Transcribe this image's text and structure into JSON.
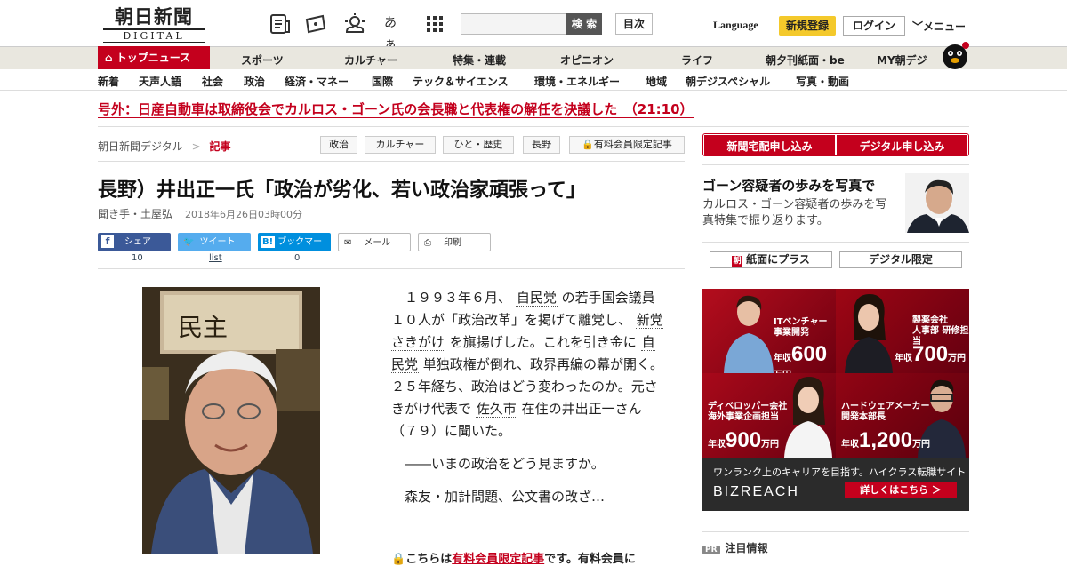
{
  "header": {
    "logo_jp": "朝日新聞",
    "logo_en": "DIGITAL",
    "search_button": "検 索",
    "index_button": "目次",
    "language": "Language",
    "register": "新規登録",
    "login": "ログイン",
    "menu": "メニュー",
    "icons": [
      "newspaper-icon",
      "coupon-icon",
      "weather-icon",
      "font-size-icon",
      "grid-icon"
    ],
    "font_size_label": "あぁ"
  },
  "nav_primary": {
    "top_news": "トップニュース",
    "items": [
      "スポーツ",
      "カルチャー",
      "特集・連載",
      "オピニオン",
      "ライフ",
      "朝夕刊紙面・be",
      "MY朝デジ"
    ]
  },
  "nav_secondary": {
    "items": [
      "新着",
      "天声人語",
      "社会",
      "政治",
      "経済・マネー",
      "国際",
      "テック＆サイエンス",
      "環境・エネルギー",
      "地域",
      "朝デジスペシャル",
      "写真・動画"
    ]
  },
  "breaking": "号外：日産自動車は取締役会でカルロス・ゴーン氏の会長職と代表権の解任を決議した　（21:10）",
  "breadcrumb": {
    "home": "朝日新聞デジタル",
    "separator": ">",
    "current": "記事"
  },
  "tags": [
    "政治",
    "カルチャー",
    "ひと・歴史",
    "長野",
    "有料会員限定記事"
  ],
  "article": {
    "headline": "長野）井出正一氏「政治が劣化、若い政治家頑張って」",
    "author": "聞き手・土屋弘",
    "date": "2018年6月26日03時00分",
    "paragraph1_parts": [
      "１９９３年６月、",
      "自民党",
      "の若手国会議員１０人が「政治改革」を掲げて離党し、",
      "新党さきがけ",
      "を旗揚げした。これを引き金に",
      "自民党",
      "単独政権が倒れ、政界再編の幕が開く。２５年経ち、政治はどう変わったのか。元さきがけ代表で",
      "佐久市",
      "在住の井出正一さん（７９）に聞いた。"
    ],
    "paragraph2": "――いまの政治をどう見ますか。",
    "paragraph3": "森友・加計問題、公文書の改ざ…",
    "paid_notice_pre": "こちらは",
    "paid_notice_link": "有料会員限定記事",
    "paid_notice_post": "です。有料会員に"
  },
  "share": {
    "facebook_label": "シェア",
    "facebook_count": "10",
    "twitter_label": "ツイート",
    "twitter_count": "list",
    "hatena_label": "ブックマーク",
    "hatena_count": "0",
    "mail_label": "メール",
    "print_label": "印刷",
    "colors": {
      "facebook": "#3b5998",
      "twitter": "#55acee",
      "hatena": "#008fde"
    }
  },
  "sidebar": {
    "subscribe_paper": "新聞宅配申し込み",
    "subscribe_digital": "デジタル申し込み",
    "feature_title": "ゴーン容疑者の歩みを写真で",
    "feature_text": "カルロス・ゴーン容疑者の歩みを写真特集で振り返ります。",
    "plus_button": "紙面にプラス",
    "digital_only": "デジタル限定",
    "ad": {
      "jobs": [
        {
          "title": "ITベンチャー\n事業開発",
          "salary": "600",
          "prefix": "年収",
          "unit": "万円"
        },
        {
          "title": "製薬会社\n人事部 研修担当",
          "salary": "700",
          "prefix": "年収",
          "unit": "万円"
        },
        {
          "title": "ディベロッパー会社\n海外事業企画担当",
          "salary": "900",
          "prefix": "年収",
          "unit": "万円"
        },
        {
          "title": "ハードウェアメーカー\n開発本部長",
          "salary": "1,200",
          "prefix": "年収",
          "unit": "万円"
        }
      ],
      "tagline": "ワンランク上のキャリアを目指す。ハイクラス転職サイト",
      "brand": "BIZREACH",
      "more": "詳しくはこちら ＞"
    },
    "pr_badge": "PR",
    "pr_title": "注目情報"
  },
  "colors": {
    "brand_red": "#c4001d",
    "register_yellow": "#f4c92b"
  }
}
